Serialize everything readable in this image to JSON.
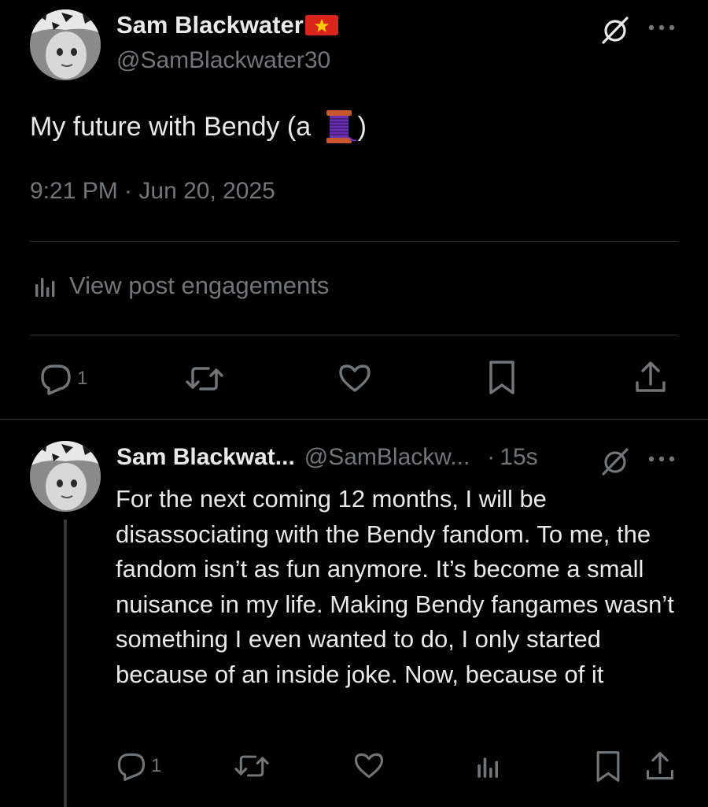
{
  "post": {
    "author_name": "Sam Blackwater",
    "author_handle": "@SamBlackwater30",
    "text_before_emoji": "My future with Bendy (a ",
    "text_after_emoji": ")",
    "emoji": "spool-of-thread-emoji",
    "timestamp": "9:21 PM · Jun 20, 2025",
    "view_engagements_label": "View post engagements",
    "actions": {
      "reply_count": "1"
    },
    "icons": [
      "grok-icon",
      "more-icon",
      "flag-icon",
      "analytics-icon",
      "reply-icon",
      "repost-icon",
      "like-icon",
      "bookmark-icon",
      "share-icon"
    ]
  },
  "reply": {
    "author_name": "Sam Blackwat...",
    "author_handle": "@SamBlackw...",
    "separator": "·",
    "time_ago": "15s",
    "text": "For the next coming 12 months, I will be disassociating with the Bendy fandom. To me, the fandom isn’t as fun anymore. It’s become a small nuisance in my life. Making Bendy fangames wasn’t something I even wanted to do, I only started because of an inside joke. Now, because of it",
    "actions": {
      "reply_count": "1"
    }
  },
  "colors": {
    "background": "#000000",
    "primary_text": "#e7e9ea",
    "secondary_text": "#71767b",
    "divider": "#2f3336",
    "flag_red": "#da251d",
    "flag_star": "#ffcd00"
  }
}
